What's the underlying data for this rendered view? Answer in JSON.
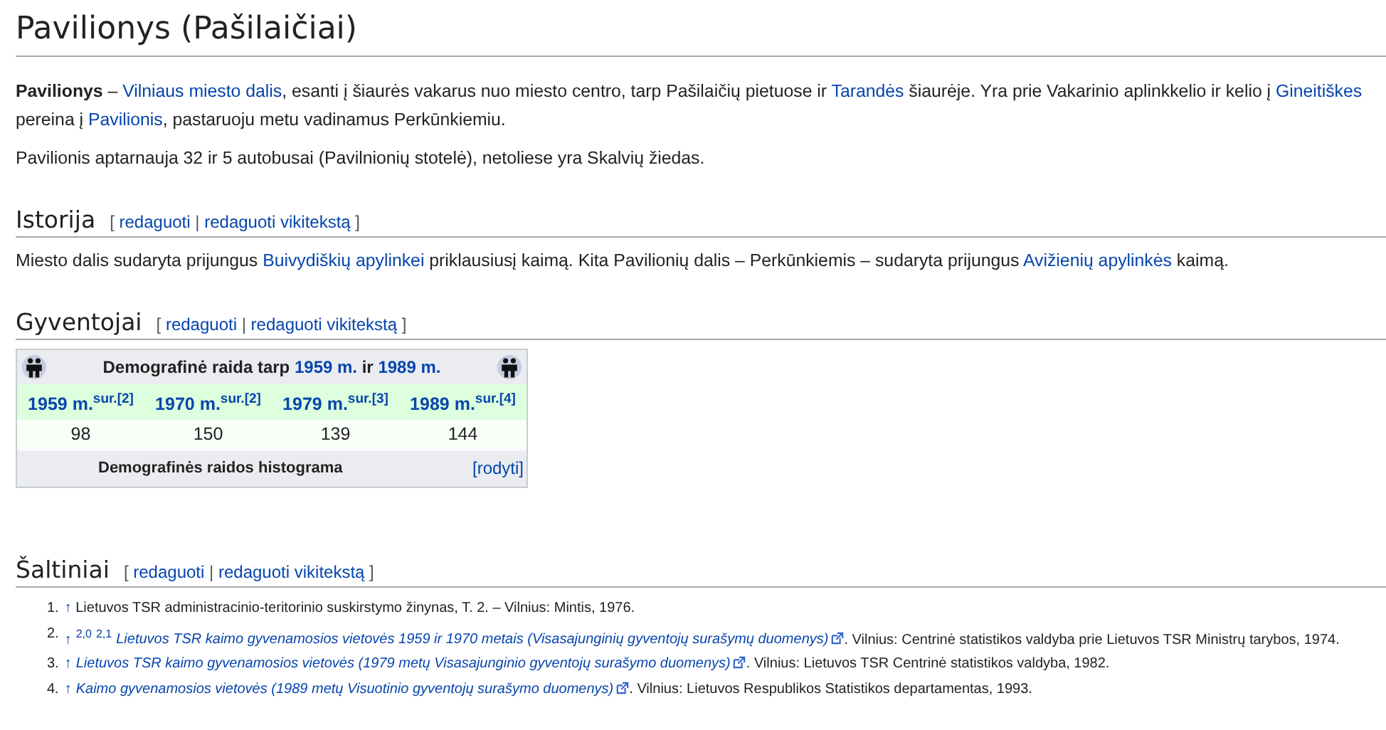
{
  "title": "Pavilionys (Pašilaičiai)",
  "intro": [
    {
      "lines": [
        [
          {
            "text": "Pavilionys",
            "kind": "bold"
          },
          {
            "text": " – ",
            "kind": "plain"
          },
          {
            "text": "Vilniaus miesto dalis",
            "kind": "link"
          },
          {
            "text": ", esanti į šiaurės vakarus nuo miesto centro, tarp Pašilaičių pietuose ir ",
            "kind": "plain"
          },
          {
            "text": "Tarandės",
            "kind": "link"
          },
          {
            "text": " šiaurėje. Yra prie Vakarinio aplinkkelio ir kelio į ",
            "kind": "plain"
          },
          {
            "text": "Gineitiškes",
            "kind": "link"
          }
        ],
        [
          {
            "text": "pereina į ",
            "kind": "plain"
          },
          {
            "text": "Pavilionis",
            "kind": "link"
          },
          {
            "text": ", pastaruoju metu vadinamus Perkūnkiemiu.",
            "kind": "plain"
          }
        ]
      ]
    },
    {
      "lines": [
        [
          {
            "text": "Pavilionis aptarnauja 32 ir 5 autobusai (Pavilnionių stotelė), netoliese yra Skalvių žiedas.",
            "kind": "plain"
          }
        ]
      ]
    }
  ],
  "sections": [
    {
      "heading": "Istorija",
      "edit": [
        {
          "text": "[ ",
          "kind": "plain"
        },
        {
          "text": "redaguoti",
          "kind": "link"
        },
        {
          "text": " | ",
          "kind": "plain"
        },
        {
          "text": "redaguoti vikitekstą",
          "kind": "link"
        },
        {
          "text": " ]",
          "kind": "plain"
        }
      ],
      "paragraphs": [
        [
          {
            "text": "Miesto dalis sudaryta prijungus ",
            "kind": "plain"
          },
          {
            "text": "Buivydiškių apylinkei",
            "kind": "link"
          },
          {
            "text": " priklausiusį kaimą. Kita Pavilionių dalis – Perkūnkiemis – sudaryta prijungus ",
            "kind": "plain"
          },
          {
            "text": "Avižienių apylinkės",
            "kind": "link"
          },
          {
            "text": " kaimą.",
            "kind": "plain"
          }
        ]
      ]
    },
    {
      "heading": "Gyventojai",
      "edit": [
        {
          "text": "[ ",
          "kind": "plain"
        },
        {
          "text": "redaguoti",
          "kind": "link"
        },
        {
          "text": " | ",
          "kind": "plain"
        },
        {
          "text": "redaguoti vikitekstą",
          "kind": "link"
        },
        {
          "text": " ]",
          "kind": "plain"
        }
      ],
      "demography": {
        "caption": [
          {
            "text": "Demografinė raida tarp ",
            "kind": "plain"
          },
          {
            "text": "1959 m.",
            "kind": "link"
          },
          {
            "text": " ir ",
            "kind": "plain"
          },
          {
            "text": "1989 m.",
            "kind": "link"
          }
        ],
        "years": [
          "1959 m.$^{sur.[2]}$",
          "1970 m.$^{sur.[2]}$",
          "1979 m.$^{sur.[3]}$",
          "1989 m.$^{sur.[4]}$"
        ],
        "values": [
          "98",
          "150",
          "139",
          "144"
        ],
        "footer": "Demografinės raidos histograma",
        "toggle": "[rodyti]"
      }
    },
    {
      "heading": "Šaltiniai",
      "edit": [
        {
          "text": "[ ",
          "kind": "plain"
        },
        {
          "text": "redaguoti",
          "kind": "link"
        },
        {
          "text": " | ",
          "kind": "plain"
        },
        {
          "text": "redaguoti vikitekstą",
          "kind": "link"
        },
        {
          "text": " ]",
          "kind": "plain"
        }
      ],
      "references": [
        {
          "number": "1.",
          "segments": [
            {
              "text": "↑",
              "kind": "link"
            },
            {
              "text": " Lietuvos TSR administracinio-teritorinio suskirstymo žinynas, T. 2. – Vilnius: Mintis, 1976.",
              "kind": "plain"
            }
          ]
        },
        {
          "number": "2.",
          "segments": [
            {
              "text": "↑",
              "kind": "link"
            },
            {
              "text": "2,0",
              "kind": "sup-link"
            },
            {
              "text": "2,1",
              "kind": "sup-link"
            },
            {
              "text": "Lietuvos TSR kaimo gyvenamosios vietovės 1959 ir 1970 metais (Visasajunginių gyventojų surašymų duomenys)",
              "kind": "external-link"
            },
            {
              "text": ". Vilnius: Centrinė statistikos valdyba prie Lietuvos TSR Ministrų tarybos, 1974.",
              "kind": "plain"
            }
          ]
        },
        {
          "number": "3.",
          "segments": [
            {
              "text": "↑",
              "kind": "link"
            },
            {
              "text": "Lietuvos TSR kaimo gyvenamosios vietovės (1979 metų Visasajunginio gyventojų surašymo duomenys)",
              "kind": "external-link"
            },
            {
              "text": ". Vilnius: Lietuvos TSR Centrinė statistikos valdyba, 1982.",
              "kind": "plain"
            }
          ]
        },
        {
          "number": "4.",
          "segments": [
            {
              "text": "↑",
              "kind": "link"
            },
            {
              "text": "Kaimo gyvenamosios vietovės (1989 metų Visuotinio gyventojų surašymo duomenys)",
              "kind": "external-link"
            },
            {
              "text": ". Vilnius: Lietuvos Respublikos Statistikos departamentas, 1993.",
              "kind": "plain"
            }
          ]
        }
      ]
    }
  ]
}
